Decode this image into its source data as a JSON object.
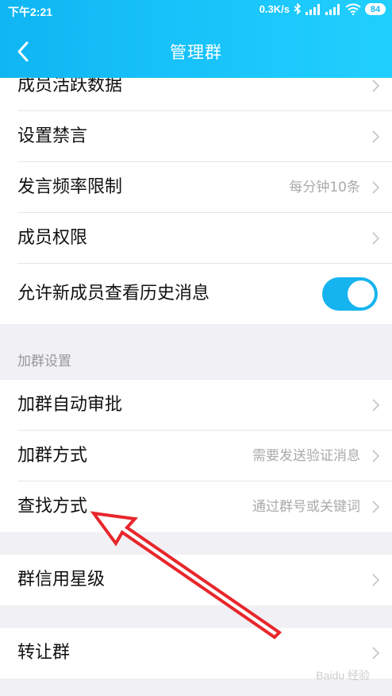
{
  "status_bar": {
    "time": "下午2:21",
    "network_speed": "0.3K/s",
    "battery": "84",
    "icons": [
      "bluetooth-icon",
      "signal-icon",
      "signal-icon",
      "wifi-icon"
    ]
  },
  "nav": {
    "title": "管理群",
    "back_icon": "chevron-left-icon"
  },
  "group1": [
    {
      "label": "成员活跃数据"
    },
    {
      "label": "设置禁言"
    },
    {
      "label": "发言频率限制",
      "value": "每分钟10条"
    },
    {
      "label": "成员权限"
    },
    {
      "label": "允许新成员查看历史消息",
      "toggle_on": true
    }
  ],
  "join_section": {
    "header": "加群设置",
    "items": [
      {
        "label": "加群自动审批"
      },
      {
        "label": "加群方式",
        "value": "需要发送验证消息"
      },
      {
        "label": "查找方式",
        "value": "通过群号或关键词"
      }
    ]
  },
  "credit": {
    "label": "群信用星级"
  },
  "transfer": {
    "label": "转让群"
  },
  "annotation": {
    "type": "red-arrow",
    "color": "#e8262b",
    "points_to": "查找方式"
  },
  "watermark": "Baidu 经验",
  "colors": {
    "header": "#19c4fb",
    "toggle": "#16b4ef",
    "arrow": "#e8262b"
  }
}
